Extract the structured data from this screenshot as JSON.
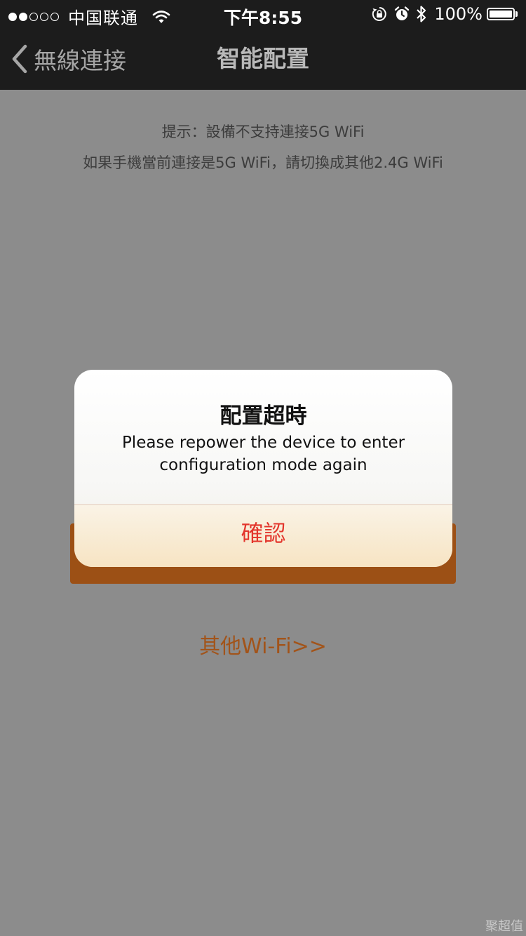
{
  "status_bar": {
    "carrier": "中国联通",
    "time": "下午8:55",
    "battery_percent": "100%",
    "battery_level": 1.0,
    "signal_bars_filled": 2,
    "signal_bars_total": 5,
    "icons": [
      "wifi-icon",
      "orientation-lock-icon",
      "alarm-icon",
      "bluetooth-icon",
      "battery-icon"
    ]
  },
  "nav": {
    "back_label": "無線連接",
    "title": "智能配置"
  },
  "content": {
    "tip_line1": "提示：設備不支持連接5G WiFi",
    "tip_line2": "如果手機當前連接是5G WiFi，請切換成其他2.4G WiFi",
    "other_wifi_link": "其他Wi-Fi>>",
    "watermark": "聚超值"
  },
  "alert": {
    "title": "配置超時",
    "message": "Please repower the device to enter configuration mode again",
    "confirm_label": "確認"
  },
  "colors": {
    "nav_background": "#1c1c1c",
    "overlay_background": "#8c8c8c",
    "primary_button": "#9c5015",
    "link_text": "#a2541a",
    "alert_button_text": "#e3352c"
  }
}
